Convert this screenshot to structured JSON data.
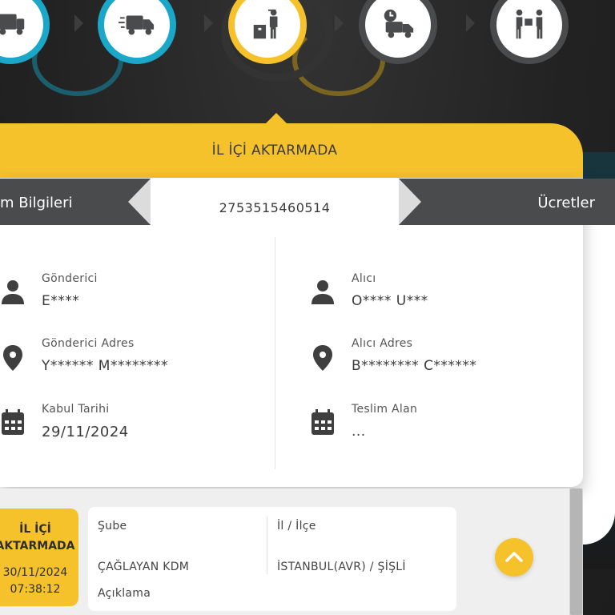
{
  "steps": [
    {
      "icon": "truck-front-icon"
    },
    {
      "icon": "moving-truck-icon"
    },
    {
      "icon": "courier-with-package-icon",
      "active": true
    },
    {
      "icon": "scheduled-delivery-truck-icon"
    },
    {
      "icon": "package-handover-icon"
    }
  ],
  "status": {
    "title": "İL İÇİ AKTARMADA"
  },
  "tabs": {
    "left": "m Bilgileri",
    "right": "Ücretler"
  },
  "tracking_number": "2753515460514",
  "sender": {
    "name_label": "Gönderici",
    "name": "E****",
    "address_label": "Gönderici Adres",
    "address": "Y****** M********",
    "date_label": "Kabul Tarihi",
    "date": "29/11/2024"
  },
  "receiver": {
    "name_label": "Alıcı",
    "name": "O**** U***",
    "address_label": "Alıcı Adres",
    "address": "B******** C******",
    "deliver_label": "Teslim Alan",
    "deliver": "..."
  },
  "movement": {
    "status_line1": "İL İÇİ",
    "status_line2": "AKTARMADA",
    "date": "30/11/2024",
    "time": "07:38:12",
    "branch_label": "Şube",
    "branch": "ÇAĞLAYAN KDM",
    "city_label": "İl / İlçe",
    "city": "İSTANBUL(AVR) / ŞİŞLİ",
    "desc_label": "Açıklama"
  },
  "colors": {
    "accent": "#f6c22c",
    "teal": "#1aa7c8",
    "dark": "#4a4b4d"
  }
}
